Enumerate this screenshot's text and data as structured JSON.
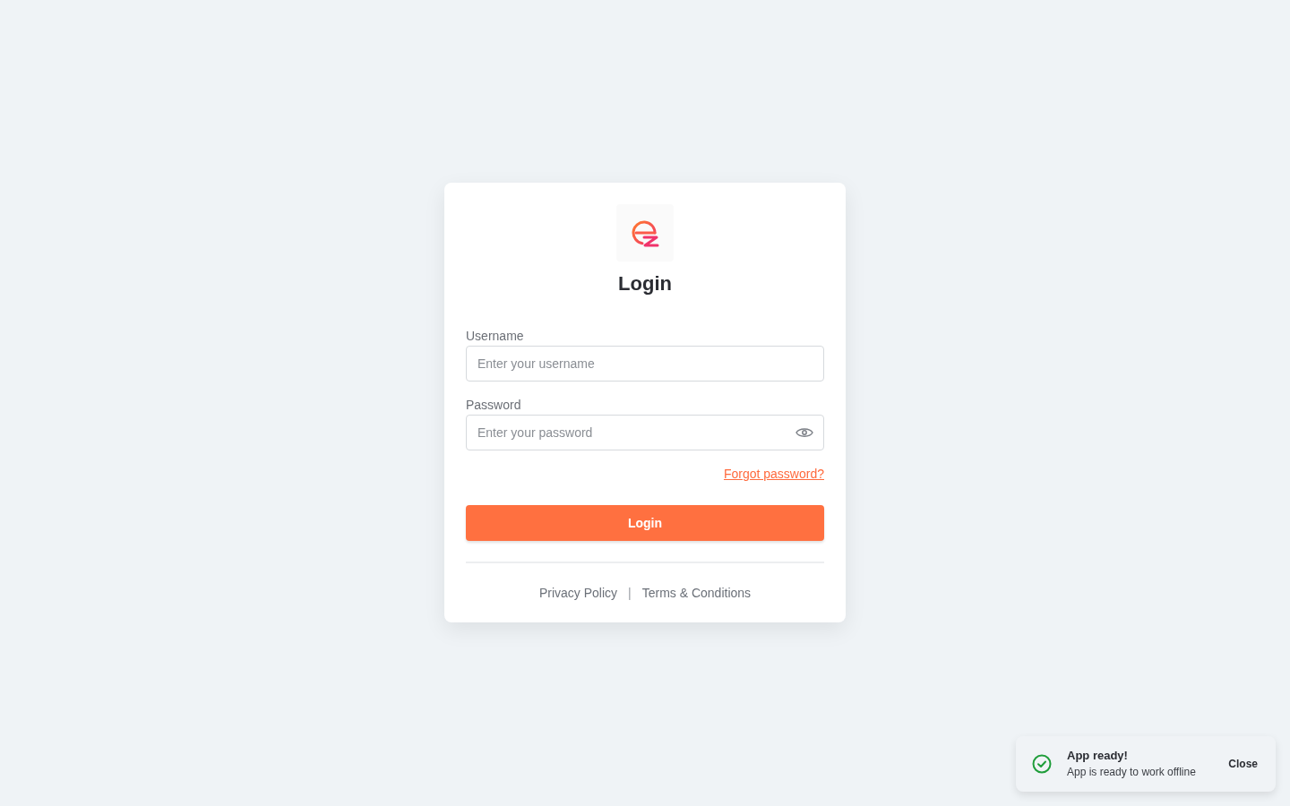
{
  "card": {
    "title": "Login",
    "fields": [
      {
        "kind": "text",
        "label": "Username",
        "placeholder": "Enter your username"
      },
      {
        "kind": "password",
        "label": "Password",
        "placeholder": "Enter your password"
      }
    ],
    "forgot_link": "Forgot password?",
    "submit_button": "Login",
    "footer": {
      "links": [
        "Privacy Policy",
        "Terms & Conditions"
      ],
      "separator": "|"
    }
  },
  "toast": {
    "kind": "success",
    "title": "App ready!",
    "message": "App is ready to work offline",
    "close_button": "Close"
  }
}
